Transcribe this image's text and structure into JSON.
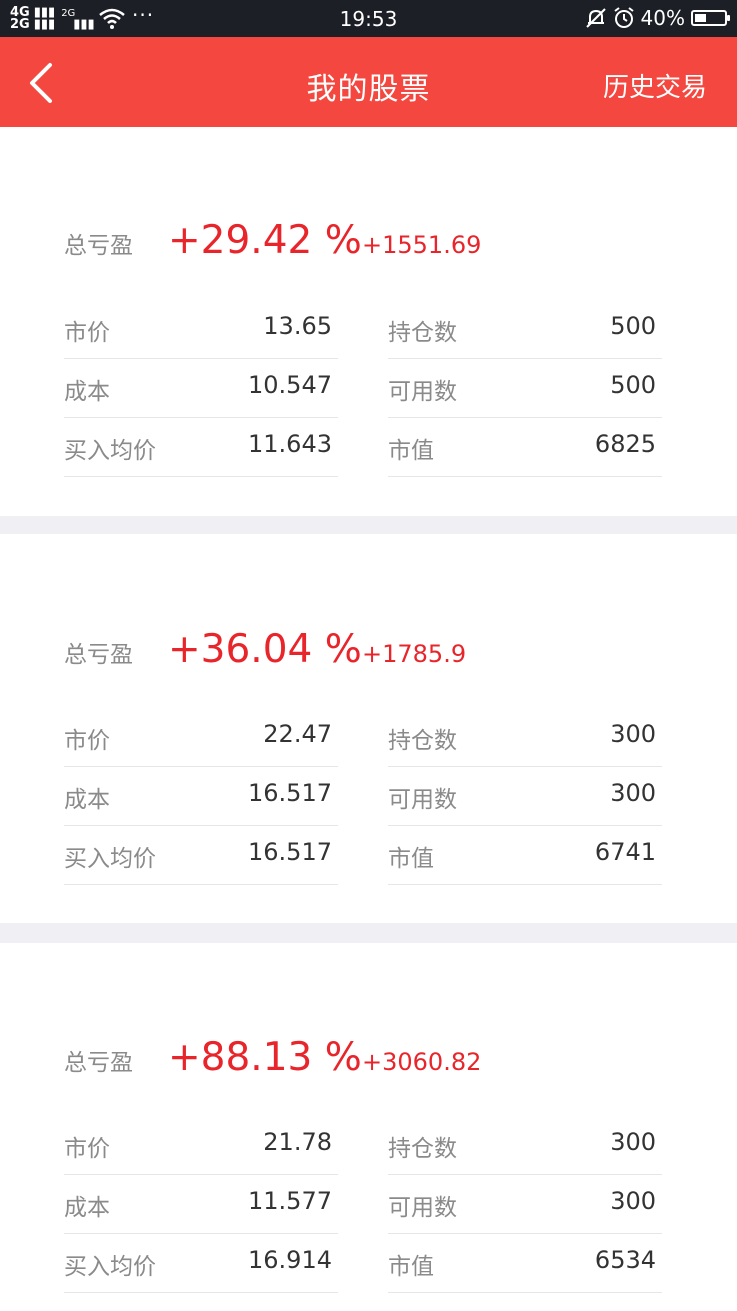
{
  "status_bar": {
    "signal_1": "4G",
    "signal_2": "2G",
    "signal_3": "2G",
    "more": "···",
    "time": "19:53",
    "battery_pct": "40%",
    "battery_level": 0.4,
    "icons": [
      "signal-icon",
      "wifi-icon",
      "mute-bell-icon",
      "alarm-icon",
      "battery-icon"
    ]
  },
  "nav": {
    "back_icon": "chevron-left-icon",
    "title": "我的股票",
    "history": "历史交易"
  },
  "colors": {
    "accent": "#f4473f",
    "profit": "#e8252a",
    "label": "#8a8a8a",
    "divider": "#efeff4"
  },
  "stocks": [
    {
      "pnl_label": "总亏盈",
      "pnl_pct": "+29.42 %",
      "pnl_amount": "+1551.69",
      "fields": {
        "price_label": "市价",
        "price": "13.65",
        "position_label": "持仓数",
        "position": "500",
        "cost_label": "成本",
        "cost": "10.547",
        "available_label": "可用数",
        "available": "500",
        "avg_label": "买入均价",
        "avg": "11.643",
        "value_label": "市值",
        "value": "6825"
      }
    },
    {
      "pnl_label": "总亏盈",
      "pnl_pct": "+36.04 %",
      "pnl_amount": "+1785.9",
      "fields": {
        "price_label": "市价",
        "price": "22.47",
        "position_label": "持仓数",
        "position": "300",
        "cost_label": "成本",
        "cost": "16.517",
        "available_label": "可用数",
        "available": "300",
        "avg_label": "买入均价",
        "avg": "16.517",
        "value_label": "市值",
        "value": "6741"
      }
    },
    {
      "pnl_label": "总亏盈",
      "pnl_pct": "+88.13 %",
      "pnl_amount": "+3060.82",
      "fields": {
        "price_label": "市价",
        "price": "21.78",
        "position_label": "持仓数",
        "position": "300",
        "cost_label": "成本",
        "cost": "11.577",
        "available_label": "可用数",
        "available": "300",
        "avg_label": "买入均价",
        "avg": "16.914",
        "value_label": "市值",
        "value": "6534"
      }
    }
  ]
}
